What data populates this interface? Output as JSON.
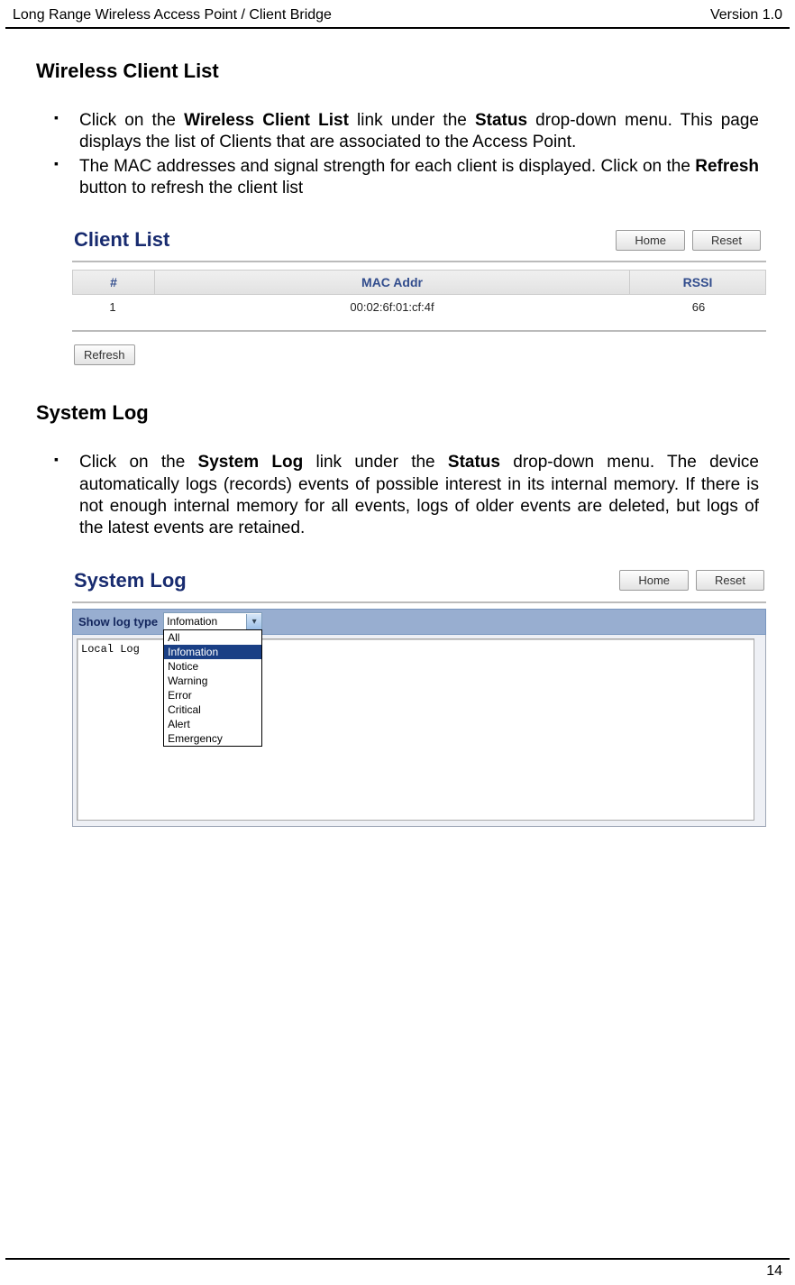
{
  "page_header": {
    "left": "Long Range Wireless Access Point / Client Bridge",
    "right": "Version 1.0"
  },
  "page_number": "14",
  "section1": {
    "title": "Wireless Client List",
    "bullet1_parts": {
      "p0": "Click on the ",
      "b0": "Wireless Client List",
      "p1": " link under the ",
      "b1": "Status",
      "p2": " drop-down menu. This page displays the list of Clients that are associated to the Access Point."
    },
    "bullet2_parts": {
      "p0": "The MAC addresses and signal strength for each client is displayed. Click on the ",
      "b0": "Refresh",
      "p1": " button to refresh the client list"
    }
  },
  "client_list_shot": {
    "title": "Client List",
    "home_btn": "Home",
    "reset_btn": "Reset",
    "th_num": "#",
    "th_mac": "MAC Addr",
    "th_rssi": "RSSI",
    "row1_num": "1",
    "row1_mac": "00:02:6f:01:cf:4f",
    "row1_rssi": "66",
    "refresh_btn": "Refresh"
  },
  "section2": {
    "title": "System Log",
    "bullet1_parts": {
      "p0": "Click on the ",
      "b0": "System Log",
      "p1": " link under the ",
      "b1": "Status",
      "p2": " drop-down menu. The device automatically logs (records) events of possible interest in its internal memory. If there is not enough internal memory for all events, logs of older events are deleted, but logs of the latest events are retained."
    }
  },
  "syslog_shot": {
    "title": "System Log",
    "home_btn": "Home",
    "reset_btn": "Reset",
    "show_log_label": "Show log type",
    "selected": "Infomation",
    "options": {
      "o0": "All",
      "o1": "Infomation",
      "o2": "Notice",
      "o3": "Warning",
      "o4": "Error",
      "o5": "Critical",
      "o6": "Alert",
      "o7": "Emergency"
    },
    "log_text": "Local Log"
  }
}
